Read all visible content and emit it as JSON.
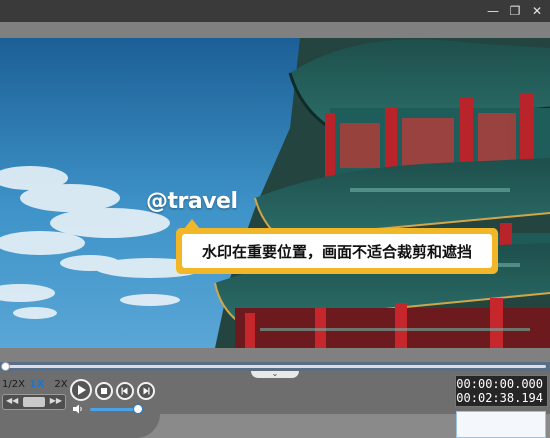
{
  "window": {
    "buttons": [
      {
        "name": "minimize",
        "glyph": "—"
      },
      {
        "name": "restore",
        "glyph": "❐"
      },
      {
        "name": "close",
        "glyph": "✕"
      }
    ]
  },
  "video": {
    "watermark": "@travel",
    "tooltip": "水印在重要位置，画面不适合裁剪和遮挡",
    "colors": {
      "sky": "#2f7fb6",
      "tooltip_border": "#f2b728"
    }
  },
  "player": {
    "speeds": [
      "1/2X",
      "1X",
      "2X"
    ],
    "active_speed": "1X",
    "seek_left": "◀◀",
    "seek_right": "▶▶",
    "time": {
      "current": "00:00:00.000",
      "total": "00:02:38.194"
    },
    "progress": 0.0,
    "volume": 0.9,
    "icons": {
      "play": "play-icon",
      "stop": "stop-icon",
      "prev_frame": "prev-frame-icon",
      "next_frame": "next-frame-icon",
      "volume": "speaker-icon",
      "expand": "chevron-down-icon"
    },
    "chevron": "⌄"
  }
}
